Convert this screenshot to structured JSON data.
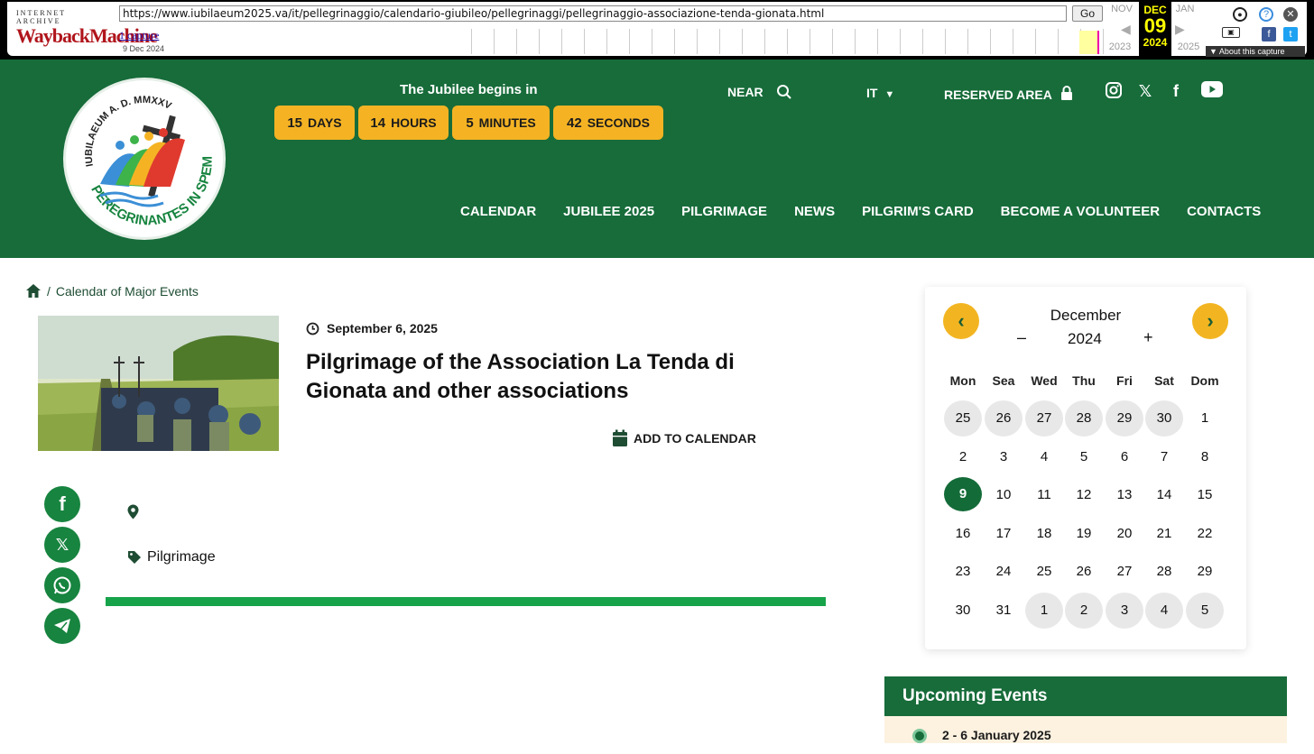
{
  "wayback": {
    "label_top": "INTERNET ARCHIVE",
    "label_logo": "WaybackMachine",
    "url": "https://www.iubilaeum2025.va/it/pellegrinaggio/calendario-giubileo/pellegrinaggi/pellegrinaggio-associazione-tenda-gionata.html",
    "go": "Go",
    "captures": "1 capture",
    "capture_date": "9 Dec 2024",
    "prev_month": "NOV",
    "cur_month": "DEC",
    "cur_day": "09",
    "cur_year": "2024",
    "next_month": "JAN",
    "prev_year": "2023",
    "next_year": "2025",
    "about": "▼ About this capture"
  },
  "header": {
    "countdown_title": "The Jubilee begins in",
    "countdown": [
      {
        "num": "15",
        "unit": "DAYS"
      },
      {
        "num": "14",
        "unit": "HOURS"
      },
      {
        "num": "5",
        "unit": "MINUTES"
      },
      {
        "num": "42",
        "unit": "SECONDS"
      }
    ],
    "near": "NEAR",
    "lang": "IT",
    "reserved": "RESERVED AREA",
    "logo_text_top": "IUBILAEUM A. D. MMXXV",
    "logo_text_bottom": "PEREGRINANTES IN SPEM",
    "nav": [
      "CALENDAR",
      "JUBILEE 2025",
      "PILGRIMAGE",
      "NEWS",
      "PILGRIM'S CARD",
      "BECOME A VOLUNTEER",
      "CONTACTS"
    ]
  },
  "breadcrumb": {
    "sep": "/",
    "current": "Calendar of Major Events"
  },
  "event": {
    "date": "September 6, 2025",
    "title": "Pilgrimage of the Association La Tenda di Gionata and other associations",
    "add_to_calendar": "ADD TO CALENDAR",
    "tag": "Pilgrimage"
  },
  "calendar": {
    "month": "December",
    "year": "2024",
    "minus": "–",
    "plus": "+",
    "prev": "‹",
    "next": "›",
    "days": [
      "Mon",
      "Sea",
      "Wed",
      "Thu",
      "Fri",
      "Sat",
      "Dom"
    ],
    "weeks": [
      [
        [
          "25",
          1
        ],
        [
          "26",
          1
        ],
        [
          "27",
          1
        ],
        [
          "28",
          1
        ],
        [
          "29",
          1
        ],
        [
          "30",
          1
        ],
        [
          "1",
          0
        ]
      ],
      [
        [
          "2",
          0
        ],
        [
          "3",
          0
        ],
        [
          "4",
          0
        ],
        [
          "5",
          0
        ],
        [
          "6",
          0
        ],
        [
          "7",
          0
        ],
        [
          "8",
          0
        ]
      ],
      [
        [
          "9",
          2
        ],
        [
          "10",
          0
        ],
        [
          "11",
          0
        ],
        [
          "12",
          0
        ],
        [
          "13",
          0
        ],
        [
          "14",
          0
        ],
        [
          "15",
          0
        ]
      ],
      [
        [
          "16",
          0
        ],
        [
          "17",
          0
        ],
        [
          "18",
          0
        ],
        [
          "19",
          0
        ],
        [
          "20",
          0
        ],
        [
          "21",
          0
        ],
        [
          "22",
          0
        ]
      ],
      [
        [
          "23",
          0
        ],
        [
          "24",
          0
        ],
        [
          "25",
          0
        ],
        [
          "26",
          0
        ],
        [
          "27",
          0
        ],
        [
          "28",
          0
        ],
        [
          "29",
          0
        ]
      ],
      [
        [
          "30",
          0
        ],
        [
          "31",
          0
        ],
        [
          "1",
          1
        ],
        [
          "2",
          1
        ],
        [
          "3",
          1
        ],
        [
          "4",
          1
        ],
        [
          "5",
          1
        ]
      ]
    ]
  },
  "upcoming": {
    "title": "Upcoming Events",
    "first": "2 - 6 January 2025"
  },
  "colors": {
    "brand_green": "#176c3a",
    "accent_yellow": "#f5b324",
    "share_green": "#17843f"
  }
}
